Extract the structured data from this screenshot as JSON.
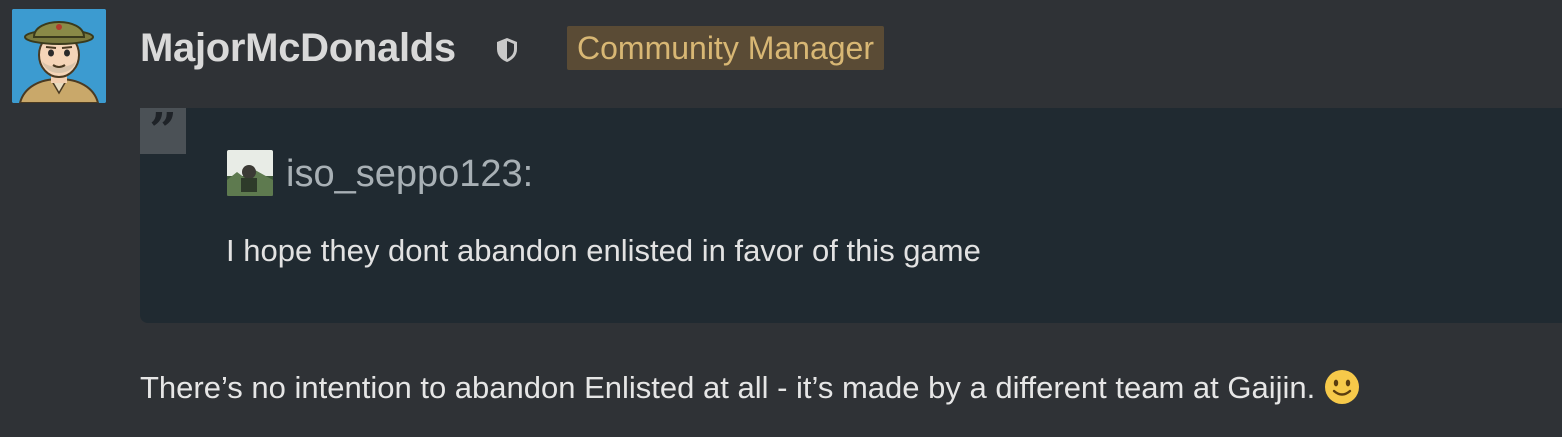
{
  "post": {
    "username": "MajorMcDonalds",
    "role_icon": "shield-icon",
    "badge": "Community Manager",
    "body": "There’s no intention to abandon Enlisted at all - it’s made by a different team at Gaijin.",
    "emoji": "slightly-smiling-face-icon"
  },
  "quote": {
    "author": "iso_seppo123:",
    "text": "I hope they dont abandon enlisted in favor of this game",
    "icon": "quote-icon"
  },
  "colors": {
    "background": "#2f3236",
    "quote_background": "#202a31",
    "badge_background": "#5a4b35",
    "badge_text": "#d8b774"
  }
}
